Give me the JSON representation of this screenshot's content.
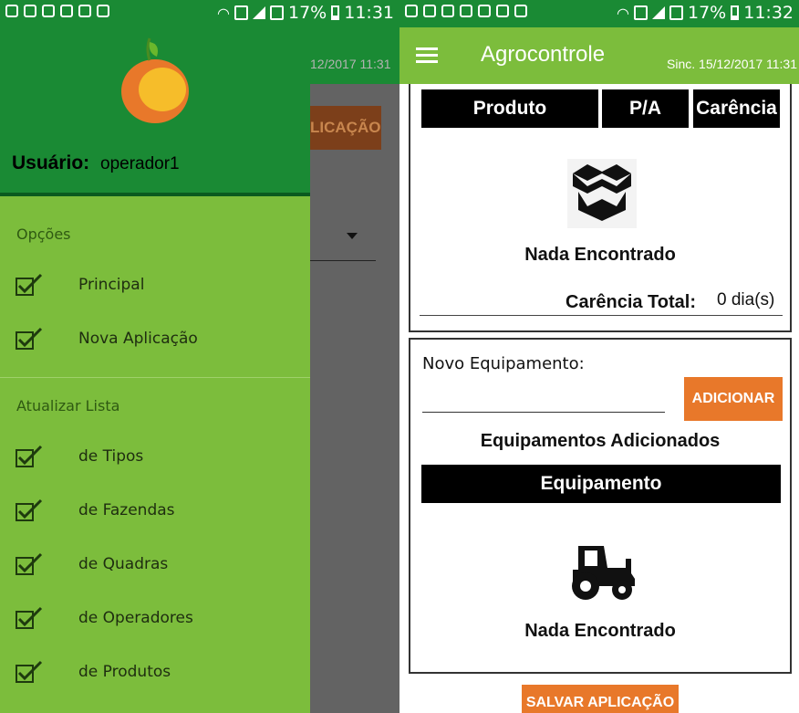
{
  "status_bar": {
    "left": {
      "battery_percent": "17%",
      "time": "11:31",
      "sim": "2"
    },
    "right": {
      "battery_percent": "17%",
      "time": "11:32",
      "sim": "2"
    }
  },
  "background_screen": {
    "sinc_fragment": "12/2017 11:31",
    "button_fragment": "LICAÇÃO"
  },
  "drawer": {
    "user_label": "Usuário:",
    "user_value": "operador1",
    "sections": [
      {
        "title": "Opções",
        "items": [
          "Principal",
          "Nova Aplicação"
        ]
      },
      {
        "title": "Atualizar Lista",
        "items": [
          "de Tipos",
          "de Fazendas",
          "de Quadras",
          "de Operadores",
          "de Produtos"
        ]
      }
    ]
  },
  "app": {
    "title": "Agrocontrole",
    "sinc": "Sinc. 15/12/2017 11:31",
    "products_table": {
      "headers": [
        "Produto",
        "P/A",
        "Carência"
      ],
      "empty_text": "Nada Encontrado"
    },
    "carencia_total_label": "Carência Total:",
    "carencia_total_value": "0 dia(s)",
    "equipment_form": {
      "label": "Novo Equipamento:",
      "value": "",
      "add_button": "ADICIONAR",
      "added_title": "Equipamentos Adicionados",
      "table_header": "Equipamento",
      "empty_text": "Nada Encontrado"
    },
    "save_button": "SALVAR APLICAÇÃO"
  },
  "colors": {
    "status_bar": "#1a8a34",
    "drawer_bg": "#7cbd3c",
    "app_bar": "#7cbd3c",
    "accent_orange": "#e8782a"
  },
  "icons": [
    "wifi-icon",
    "battery-icon",
    "signal-icon",
    "logo-orange",
    "checkbox-icon",
    "hamburger-icon",
    "open-box-icon",
    "tractor-icon"
  ]
}
